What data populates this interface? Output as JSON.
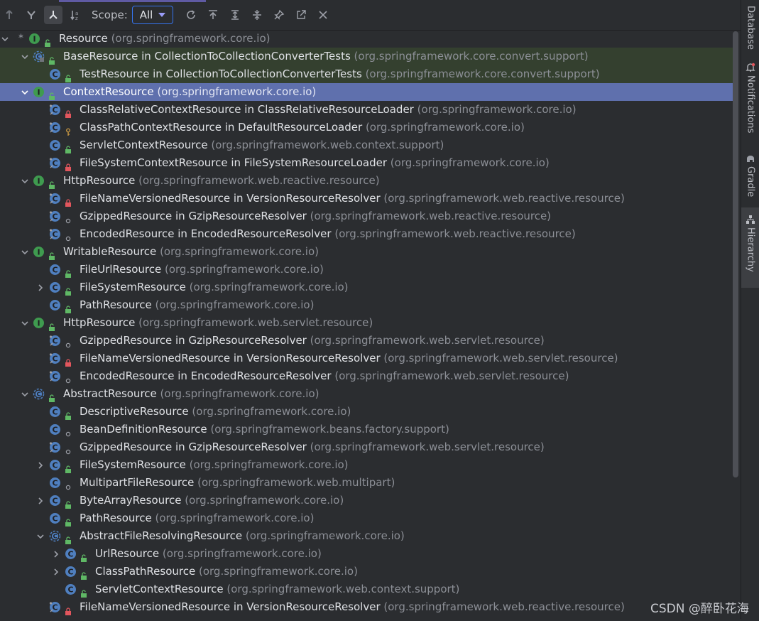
{
  "toolbar": {
    "scope_label": "Scope:",
    "scope_value": "All",
    "buttons": [
      "supertypes-hierarchy",
      "subtypes-hierarchy",
      "class-hierarchy",
      "sort-alphabetically",
      "refresh",
      "scroll-to-source",
      "expand-all",
      "collapse-all",
      "pin",
      "open-in-window",
      "close"
    ]
  },
  "tree": [
    {
      "level": 0,
      "arrow": "down",
      "star": "*",
      "icon": "interface",
      "vis": "public",
      "name": "Resource",
      "pkg": "(org.springframework.core.io)",
      "state": ""
    },
    {
      "level": 1,
      "arrow": "down",
      "icon": "abstract-test",
      "vis": "public",
      "name": "BaseResource in CollectionToCollectionConverterTests",
      "pkg": "(org.springframework.core.convert.support)",
      "state": "green"
    },
    {
      "level": 2,
      "arrow": "",
      "icon": "class",
      "vis": "public",
      "name": "TestResource in CollectionToCollectionConverterTests",
      "pkg": "(org.springframework.core.convert.support)",
      "state": "green"
    },
    {
      "level": 1,
      "arrow": "down",
      "icon": "interface",
      "vis": "public",
      "name": "ContextResource",
      "pkg": "(org.springframework.core.io)",
      "state": "selected"
    },
    {
      "level": 2,
      "arrow": "",
      "icon": "class-static",
      "vis": "private",
      "name": "ClassRelativeContextResource in ClassRelativeResourceLoader",
      "pkg": "(org.springframework.core.io)",
      "state": ""
    },
    {
      "level": 2,
      "arrow": "",
      "icon": "class-static",
      "vis": "protected",
      "name": "ClassPathContextResource in DefaultResourceLoader",
      "pkg": "(org.springframework.core.io)",
      "state": ""
    },
    {
      "level": 2,
      "arrow": "",
      "icon": "class",
      "vis": "public",
      "name": "ServletContextResource",
      "pkg": "(org.springframework.web.context.support)",
      "state": ""
    },
    {
      "level": 2,
      "arrow": "",
      "icon": "class-static",
      "vis": "private",
      "name": "FileSystemContextResource in FileSystemResourceLoader",
      "pkg": "(org.springframework.core.io)",
      "state": ""
    },
    {
      "level": 1,
      "arrow": "down",
      "icon": "interface",
      "vis": "public",
      "name": "HttpResource",
      "pkg": "(org.springframework.web.reactive.resource)",
      "state": ""
    },
    {
      "level": 2,
      "arrow": "",
      "icon": "class-static",
      "vis": "private",
      "name": "FileNameVersionedResource in VersionResourceResolver",
      "pkg": "(org.springframework.web.reactive.resource)",
      "state": ""
    },
    {
      "level": 2,
      "arrow": "",
      "icon": "class-static",
      "vis": "package",
      "name": "GzippedResource in GzipResourceResolver",
      "pkg": "(org.springframework.web.reactive.resource)",
      "state": ""
    },
    {
      "level": 2,
      "arrow": "",
      "icon": "class-static",
      "vis": "package",
      "name": "EncodedResource in EncodedResourceResolver",
      "pkg": "(org.springframework.web.reactive.resource)",
      "state": ""
    },
    {
      "level": 1,
      "arrow": "down",
      "icon": "interface",
      "vis": "public",
      "name": "WritableResource",
      "pkg": "(org.springframework.core.io)",
      "state": ""
    },
    {
      "level": 2,
      "arrow": "",
      "icon": "class",
      "vis": "public",
      "name": "FileUrlResource",
      "pkg": "(org.springframework.core.io)",
      "state": ""
    },
    {
      "level": 2,
      "arrow": "right",
      "icon": "class",
      "vis": "public",
      "name": "FileSystemResource",
      "pkg": "(org.springframework.core.io)",
      "state": ""
    },
    {
      "level": 2,
      "arrow": "",
      "icon": "class",
      "vis": "public",
      "name": "PathResource",
      "pkg": "(org.springframework.core.io)",
      "state": ""
    },
    {
      "level": 1,
      "arrow": "down",
      "icon": "interface",
      "vis": "public",
      "name": "HttpResource",
      "pkg": "(org.springframework.web.servlet.resource)",
      "state": ""
    },
    {
      "level": 2,
      "arrow": "",
      "icon": "class-static",
      "vis": "package",
      "name": "GzippedResource in GzipResourceResolver",
      "pkg": "(org.springframework.web.servlet.resource)",
      "state": ""
    },
    {
      "level": 2,
      "arrow": "",
      "icon": "class-static",
      "vis": "private",
      "name": "FileNameVersionedResource in VersionResourceResolver",
      "pkg": "(org.springframework.web.servlet.resource)",
      "state": ""
    },
    {
      "level": 2,
      "arrow": "",
      "icon": "class-static",
      "vis": "package",
      "name": "EncodedResource in EncodedResourceResolver",
      "pkg": "(org.springframework.web.servlet.resource)",
      "state": ""
    },
    {
      "level": 1,
      "arrow": "down",
      "icon": "abstract",
      "vis": "public",
      "name": "AbstractResource",
      "pkg": "(org.springframework.core.io)",
      "state": ""
    },
    {
      "level": 2,
      "arrow": "",
      "icon": "class",
      "vis": "public",
      "name": "DescriptiveResource",
      "pkg": "(org.springframework.core.io)",
      "state": ""
    },
    {
      "level": 2,
      "arrow": "",
      "icon": "class",
      "vis": "package",
      "name": "BeanDefinitionResource",
      "pkg": "(org.springframework.beans.factory.support)",
      "state": ""
    },
    {
      "level": 2,
      "arrow": "",
      "icon": "class-static",
      "vis": "package",
      "name": "GzippedResource in GzipResourceResolver",
      "pkg": "(org.springframework.web.servlet.resource)",
      "state": ""
    },
    {
      "level": 2,
      "arrow": "right",
      "icon": "class",
      "vis": "public",
      "name": "FileSystemResource",
      "pkg": "(org.springframework.core.io)",
      "state": ""
    },
    {
      "level": 2,
      "arrow": "",
      "icon": "class",
      "vis": "package",
      "name": "MultipartFileResource",
      "pkg": "(org.springframework.web.multipart)",
      "state": ""
    },
    {
      "level": 2,
      "arrow": "right",
      "icon": "class",
      "vis": "public",
      "name": "ByteArrayResource",
      "pkg": "(org.springframework.core.io)",
      "state": ""
    },
    {
      "level": 2,
      "arrow": "",
      "icon": "class",
      "vis": "public",
      "name": "PathResource",
      "pkg": "(org.springframework.core.io)",
      "state": ""
    },
    {
      "level": 2,
      "arrow": "down",
      "icon": "abstract",
      "vis": "public",
      "name": "AbstractFileResolvingResource",
      "pkg": "(org.springframework.core.io)",
      "state": ""
    },
    {
      "level": 3,
      "arrow": "right",
      "icon": "class",
      "vis": "public",
      "name": "UrlResource",
      "pkg": "(org.springframework.core.io)",
      "state": ""
    },
    {
      "level": 3,
      "arrow": "right",
      "icon": "class",
      "vis": "public",
      "name": "ClassPathResource",
      "pkg": "(org.springframework.core.io)",
      "state": ""
    },
    {
      "level": 3,
      "arrow": "",
      "icon": "class",
      "vis": "public",
      "name": "ServletContextResource",
      "pkg": "(org.springframework.web.context.support)",
      "state": ""
    },
    {
      "level": 2,
      "arrow": "",
      "icon": "class-static",
      "vis": "private",
      "name": "FileNameVersionedResource in VersionResourceResolver",
      "pkg": "(org.springframework.web.reactive.resource)",
      "state": ""
    }
  ],
  "right_strip": [
    {
      "label": "Database",
      "icon": "database-icon",
      "active": false
    },
    {
      "label": "Notifications",
      "icon": "bell-icon",
      "active": false
    },
    {
      "label": "Gradle",
      "icon": "elephant-icon",
      "active": false
    },
    {
      "label": "Hierarchy",
      "icon": "hierarchy-icon",
      "active": true
    }
  ],
  "watermark": "CSDN @醉卧花海",
  "colors": {
    "background": "#2b2d30",
    "selection": "#5f70ad",
    "green_row": "#34402f",
    "interface_icon": "#3f9b4f",
    "class_icon": "#4f7fbf",
    "public_lock": "#5fb865",
    "private_lock": "#e2565d"
  }
}
